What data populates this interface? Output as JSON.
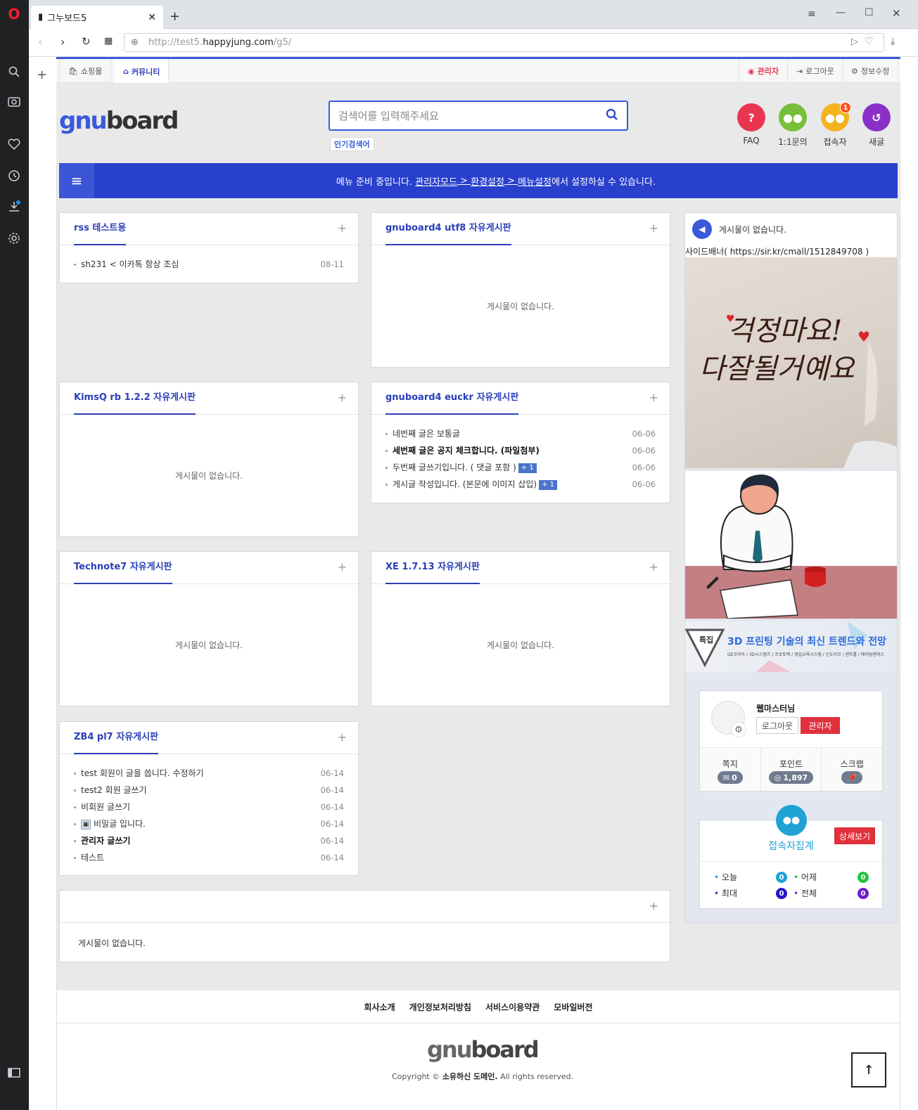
{
  "browser": {
    "tab_title": "그누보드5",
    "url_prefix": "http://test5.",
    "url_host": "happyjung.com",
    "url_path": "/g5/"
  },
  "topnav": {
    "shop": "쇼핑몰",
    "community": "커뮤니티",
    "admin": "관리자",
    "logout": "로그아웃",
    "edit_info": "정보수정"
  },
  "header": {
    "logo_a": "gnu",
    "logo_b": "board",
    "search_placeholder": "검색어를 입력해주세요",
    "hot_keywords": "인기검색어",
    "quick": [
      {
        "label": "FAQ",
        "icon": "?",
        "color": "#e9354f"
      },
      {
        "label": "1:1문의",
        "icon": "💬",
        "color": "#76bf3a"
      },
      {
        "label": "접속자",
        "icon": "👥",
        "color": "#f5b21f",
        "badge": "1"
      },
      {
        "label": "새글",
        "icon": "↺",
        "color": "#8b2fc9"
      }
    ]
  },
  "menubar": {
    "msg_a": "메뉴 준비 중입니다. ",
    "link1": "관리자모드",
    "sep1": " > ",
    "link2": "환경설정",
    "sep2": " > ",
    "link3": "메뉴설정",
    "msg_b": "에서 설정하실 수 있습니다."
  },
  "empty_text": "게시물이 없습니다.",
  "boards": {
    "rss": {
      "title": "rss 테스트용",
      "items": [
        {
          "text": "sh231 < 이카톡 항상 조심",
          "date": "08-11"
        }
      ]
    },
    "utf8": {
      "title": "gnuboard4 utf8 자유게시판"
    },
    "kimsq": {
      "title": "KimsQ rb 1.2.2 자유게시판"
    },
    "euckr": {
      "title": "gnuboard4 euckr 자유게시판",
      "items": [
        {
          "text": "네번째 글은 보통글",
          "date": "06-06",
          "bold": false,
          "cm": ""
        },
        {
          "text": "세번째 글은 공지 체크합니다. (파일첨부)",
          "date": "06-06",
          "bold": true,
          "cm": ""
        },
        {
          "text": "두번째 글쓰기입니다. ( 댓글 포함 )",
          "date": "06-06",
          "bold": false,
          "cm": "+ 1"
        },
        {
          "text": "게시글 작성입니다. (본문에 이미지 삽입)",
          "date": "06-06",
          "bold": false,
          "cm": "+ 1"
        }
      ]
    },
    "technote": {
      "title": "Technote7 자유게시판"
    },
    "xe": {
      "title": "XE 1.7.13 자유게시판"
    },
    "zb4": {
      "title": "ZB4 pl7 자유게시판",
      "items": [
        {
          "text": "test 회원이 글을 씁니다. 수정하기",
          "date": "06-14",
          "bold": false
        },
        {
          "text": "test2 회원 글쓰기",
          "date": "06-14",
          "bold": false
        },
        {
          "text": "비회원 글쓰기",
          "date": "06-14",
          "bold": false
        },
        {
          "text": "비밀글 입니다.",
          "date": "06-14",
          "bold": false,
          "lock": true
        },
        {
          "text": "관리자 글쓰기",
          "date": "06-14",
          "bold": true
        },
        {
          "text": "테스트",
          "date": "06-14",
          "bold": false
        }
      ]
    }
  },
  "sidebar": {
    "notice": "게시물이 없습니다.",
    "banner_caption": "사이드배너( https://sir.kr/cmall/1512849708 )",
    "banner1_text_a": "걱정마요!",
    "banner1_text_b": "다잘될거예요",
    "banner3_tag": "특집",
    "banner3_title": "3D 프린팅 기술의 최신 트렌드와 전망",
    "banner3_sub": "GE코리아 / 3D시스템즈 / 프로토텍 / 영일교육시스템 / 신도리코 / 센트롤 / 에이팀벤처스"
  },
  "profile": {
    "name": "웹마스터님",
    "logout": "로그아웃",
    "admin": "관리자",
    "memo_label": "쪽지",
    "memo_value": "0",
    "point_label": "포인트",
    "point_value": "1,897",
    "scrap_label": "스크랩"
  },
  "visit": {
    "title": "접속자집계",
    "detail": "상세보기",
    "today_label": "오늘",
    "today": "0",
    "yesterday_label": "어제",
    "yesterday": "0",
    "max_label": "최대",
    "max": "0",
    "total_label": "전체",
    "total": "0"
  },
  "footer": {
    "links": [
      "회사소개",
      "개인정보처리방침",
      "서비스이용약관",
      "모바일버전"
    ],
    "logo_a": "gnu",
    "logo_b": "board",
    "copy_a": "Copyright © ",
    "copy_b": "소유하신 도메인.",
    "copy_c": " All rights reserved."
  },
  "colors": {
    "accent": "#2840cc",
    "admin_red": "#e9354f",
    "visit_blue": "#1fa3d6"
  }
}
